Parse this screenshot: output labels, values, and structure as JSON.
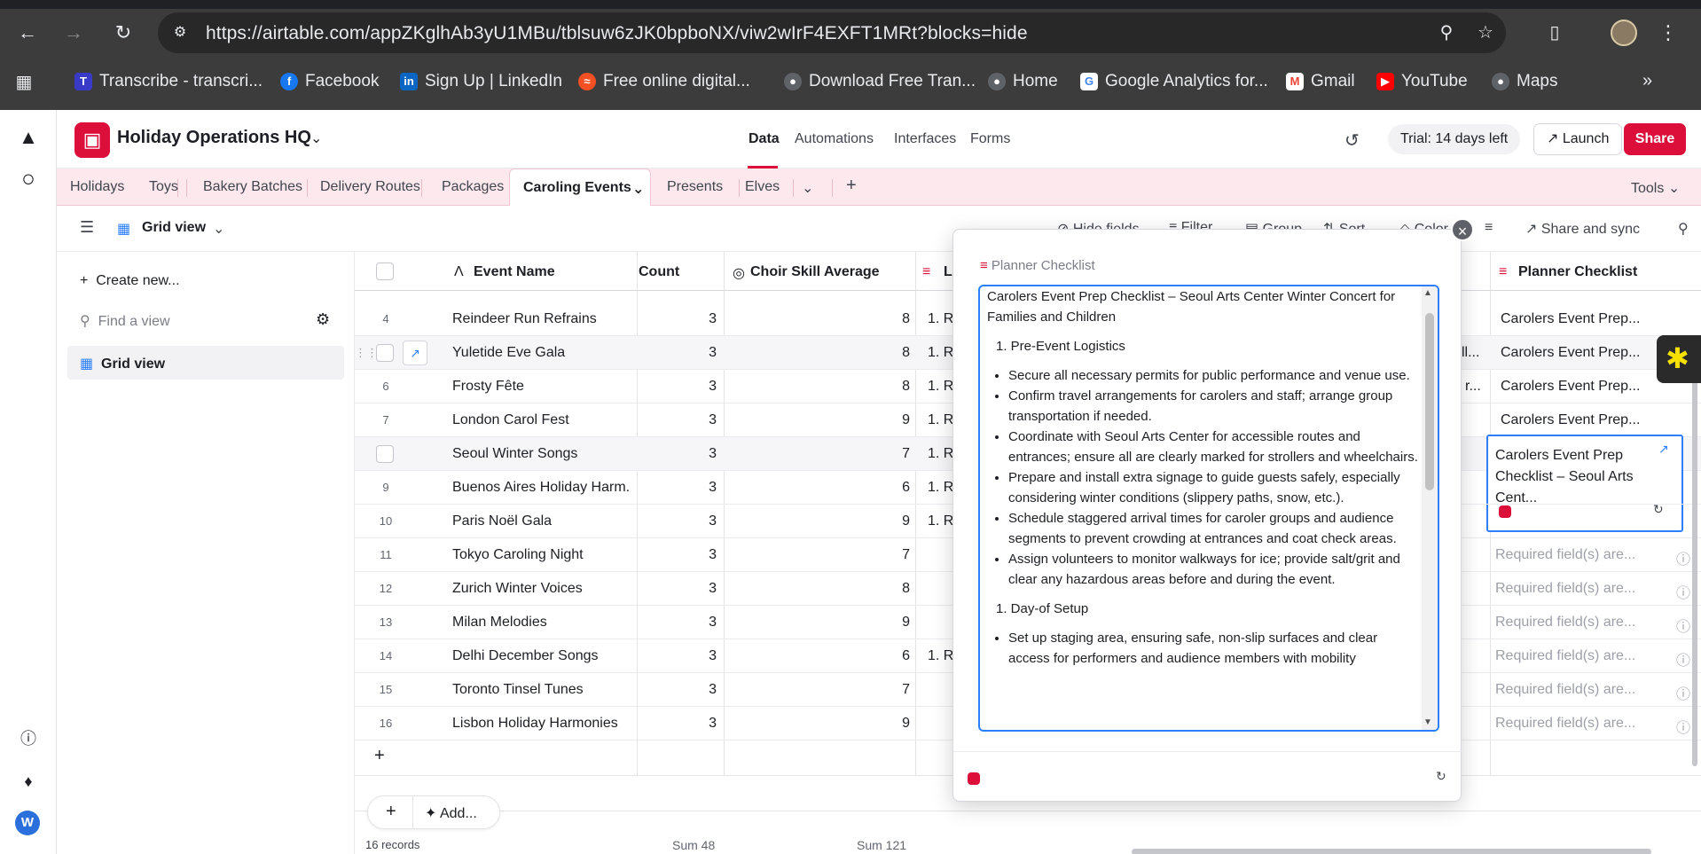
{
  "browser": {
    "url": "https://airtable.com/appZKglhAb3yU1MBu/tblsuw6zJK0bpboNX/viw2wIrF4EXFT1MRt?blocks=hide",
    "bookmarks": [
      {
        "label": "Transcribe - transcri..."
      },
      {
        "label": "Facebook"
      },
      {
        "label": "Sign Up | LinkedIn"
      },
      {
        "label": "Free online digital..."
      },
      {
        "label": "Download Free Tran..."
      },
      {
        "label": "Home"
      },
      {
        "label": "Google Analytics for..."
      },
      {
        "label": "Gmail"
      },
      {
        "label": "YouTube"
      },
      {
        "label": "Maps"
      }
    ]
  },
  "app": {
    "base_name": "Holiday Operations HQ",
    "nav": [
      "Data",
      "Automations",
      "Interfaces",
      "Forms"
    ],
    "trial": "Trial: 14 days left",
    "launch": "Launch",
    "share": "Share",
    "user_initial": "W"
  },
  "tables": [
    "Holidays",
    "Toys",
    "Bakery Batches",
    "Delivery Routes",
    "Packages",
    "Caroling Events",
    "Presents",
    "Elves"
  ],
  "tools": "Tools",
  "view_bar": {
    "view_name": "Grid view",
    "hide_fields": "Hide fields",
    "filter": "Filter",
    "group": "Group",
    "sort": "Sort",
    "color": "Color",
    "share_sync": "Share and sync"
  },
  "sidebar": {
    "create_new": "Create new...",
    "find_view": "Find a view",
    "current_view": "Grid view"
  },
  "grid": {
    "headers": {
      "event_name": "Event Name",
      "count": "Count",
      "choir": "Choir Skill Average",
      "lo": "Lo",
      "planner": "Planner Checklist"
    },
    "rows": [
      {
        "num": "4",
        "name": "Reindeer Run Refrains",
        "count": "3",
        "choir": "8",
        "lo": "1. Re",
        "col5": "",
        "planner": "Carolers Event Prep...",
        "req": false
      },
      {
        "num": "",
        "name": "Yuletide Eve Gala",
        "count": "3",
        "choir": "8",
        "lo": "1. Re",
        "col5": "ll...",
        "planner": "Carolers Event Prep...",
        "req": false
      },
      {
        "num": "6",
        "name": "Frosty Fête",
        "count": "3",
        "choir": "8",
        "lo": "1. Re",
        "col5": "r...",
        "planner": "Carolers Event Prep...",
        "req": false
      },
      {
        "num": "7",
        "name": "London Carol Fest",
        "count": "3",
        "choir": "9",
        "lo": "1. Re",
        "col5": "",
        "planner": "Carolers Event Prep...",
        "req": false
      },
      {
        "num": "",
        "name": "Seoul Winter Songs",
        "count": "3",
        "choir": "7",
        "lo": "1. Re",
        "col5": "",
        "planner": "Carolers Event Prep Checklist – Seoul Arts Cent...",
        "req": false
      },
      {
        "num": "9",
        "name": "Buenos Aires Holiday Harm...",
        "count": "3",
        "choir": "6",
        "lo": "1. Re",
        "col5": "",
        "planner": "",
        "req": false
      },
      {
        "num": "10",
        "name": "Paris Noël Gala",
        "count": "3",
        "choir": "9",
        "lo": "1. Re",
        "col5": "",
        "planner": "",
        "req": false
      },
      {
        "num": "11",
        "name": "Tokyo Caroling Night",
        "count": "3",
        "choir": "7",
        "lo": "",
        "col5": "",
        "planner": "Required field(s) are...",
        "req": true
      },
      {
        "num": "12",
        "name": "Zurich Winter Voices",
        "count": "3",
        "choir": "8",
        "lo": "",
        "col5": "",
        "planner": "Required field(s) are...",
        "req": true
      },
      {
        "num": "13",
        "name": "Milan Melodies",
        "count": "3",
        "choir": "9",
        "lo": "",
        "col5": "",
        "planner": "Required field(s) are...",
        "req": true
      },
      {
        "num": "14",
        "name": "Delhi December Songs",
        "count": "3",
        "choir": "6",
        "lo": "1. Re",
        "col5": "",
        "planner": "Required field(s) are...",
        "req": true
      },
      {
        "num": "15",
        "name": "Toronto Tinsel Tunes",
        "count": "3",
        "choir": "7",
        "lo": "",
        "col5": "",
        "planner": "Required field(s) are...",
        "req": true
      },
      {
        "num": "16",
        "name": "Lisbon Holiday Harmonies",
        "count": "3",
        "choir": "9",
        "lo": "",
        "col5": "",
        "planner": "Required field(s) are...",
        "req": true
      }
    ],
    "add_label": "Add...",
    "records": "16 records",
    "sum_count": "Sum 48",
    "sum_choir": "Sum 121"
  },
  "popup": {
    "title": "Planner Checklist",
    "intro": "Carolers Event Prep Checklist – Seoul Arts Center Winter Concert for Families and Children",
    "section1": "1. Pre-Event Logistics",
    "items1": [
      "Secure all necessary permits for public performance and venue use.",
      "Confirm travel arrangements for carolers and staff; arrange group transportation if needed.",
      "Coordinate with Seoul Arts Center for accessible routes and entrances; ensure all are clearly marked for strollers and wheelchairs.",
      "Prepare and install extra signage to guide guests safely, especially considering winter conditions (slippery paths, snow, etc.).",
      "Schedule staggered arrival times for caroler groups and audience segments to prevent crowding at entrances and coat check areas.",
      "Assign volunteers to monitor walkways for ice; provide salt/grit and clear any hazardous areas before and during the event."
    ],
    "section2": "1. Day-of Setup",
    "items2": [
      "Set up staging area, ensuring safe, non-slip surfaces and clear access for performers and audience members with mobility"
    ]
  },
  "colors": {
    "accent": "#dc0f3a",
    "tab_bar": "#fde8ee",
    "focus": "#2d7ff9"
  }
}
